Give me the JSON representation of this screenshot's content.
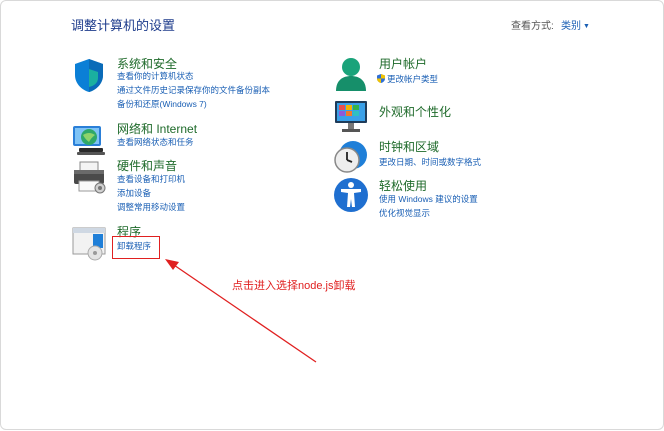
{
  "header": {
    "title": "调整计算机的设置",
    "view_by_label": "查看方式:",
    "view_by_value": "类别"
  },
  "left_categories": [
    {
      "title": "系统和安全",
      "links": [
        "查看你的计算机状态",
        "通过文件历史记录保存你的文件备份副本",
        "备份和还原(Windows 7)"
      ]
    },
    {
      "title": "网络和 Internet",
      "links": [
        "查看网络状态和任务"
      ]
    },
    {
      "title": "硬件和声音",
      "links": [
        "查看设备和打印机",
        "添加设备",
        "调整常用移动设置"
      ]
    },
    {
      "title": "程序",
      "links": [
        "卸载程序"
      ]
    }
  ],
  "right_categories": [
    {
      "title": "用户帐户",
      "links": [
        "更改帐户类型"
      ]
    },
    {
      "title": "外观和个性化",
      "links": []
    },
    {
      "title": "时钟和区域",
      "links": [
        "更改日期、时间或数字格式"
      ]
    },
    {
      "title": "轻松使用",
      "links": [
        "使用 Windows 建议的设置",
        "优化视觉显示"
      ]
    }
  ],
  "annotation": {
    "text": "点击进入选择node.js卸载",
    "color": "#e02020"
  }
}
